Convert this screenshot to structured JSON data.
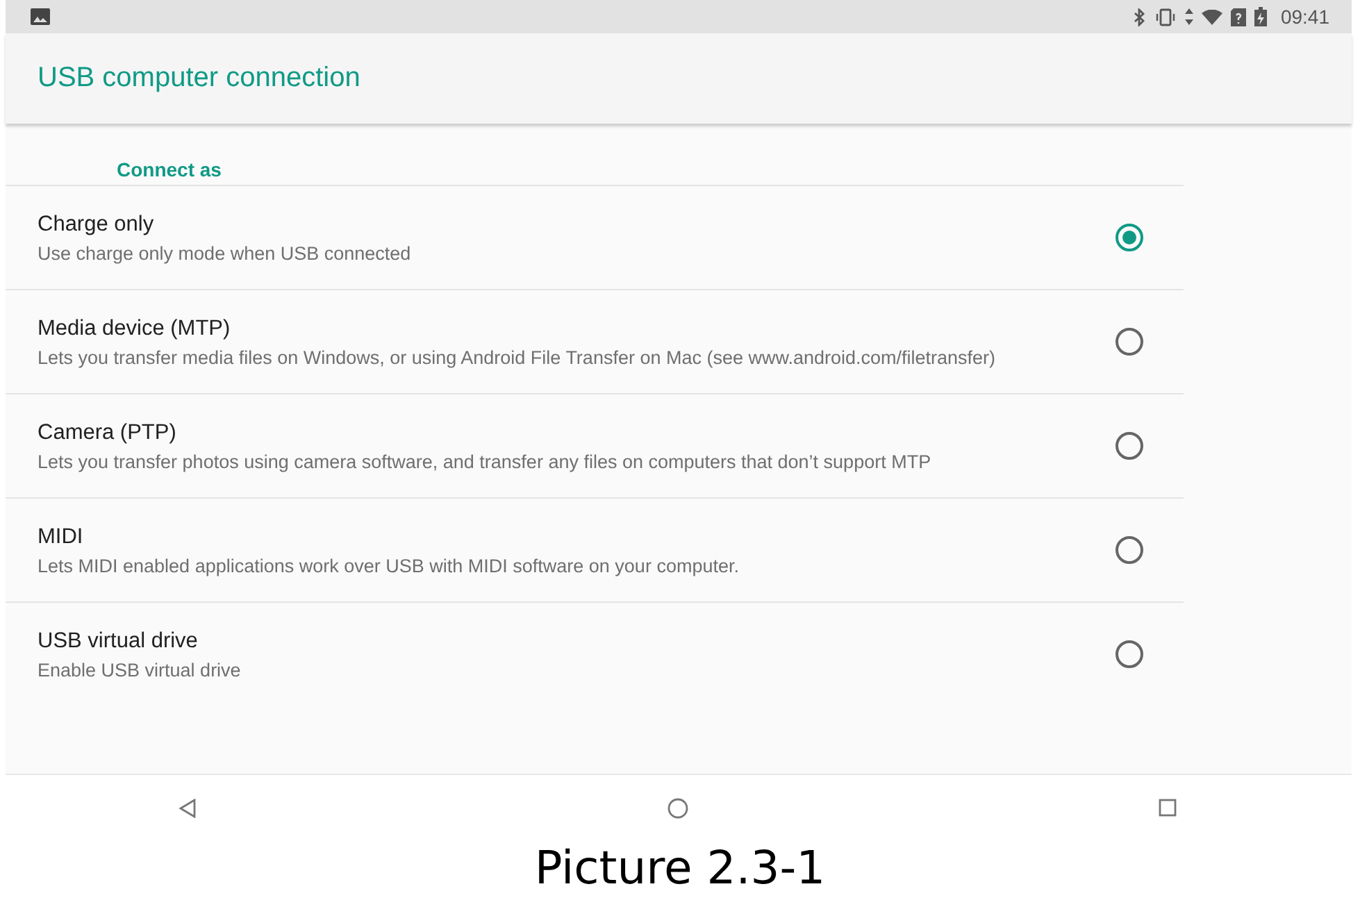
{
  "status_bar": {
    "time": "09:41"
  },
  "app_bar": {
    "title": "USB computer connection"
  },
  "section": {
    "title": "Connect as"
  },
  "options": [
    {
      "title": "Charge only",
      "summary": "Use charge only mode when USB connected",
      "selected": true
    },
    {
      "title": "Media device (MTP)",
      "summary": "Lets you transfer media files on Windows, or using Android File Transfer on Mac (see www.android.com/filetransfer)",
      "selected": false
    },
    {
      "title": "Camera (PTP)",
      "summary": "Lets you transfer photos using camera software, and transfer any files on computers that don’t support MTP",
      "selected": false
    },
    {
      "title": "MIDI",
      "summary": "Lets MIDI enabled applications work over USB with MIDI software on your computer.",
      "selected": false
    },
    {
      "title": "USB virtual drive",
      "summary": "Enable USB virtual drive",
      "selected": false
    }
  ],
  "caption": "Picture 2.3-1"
}
